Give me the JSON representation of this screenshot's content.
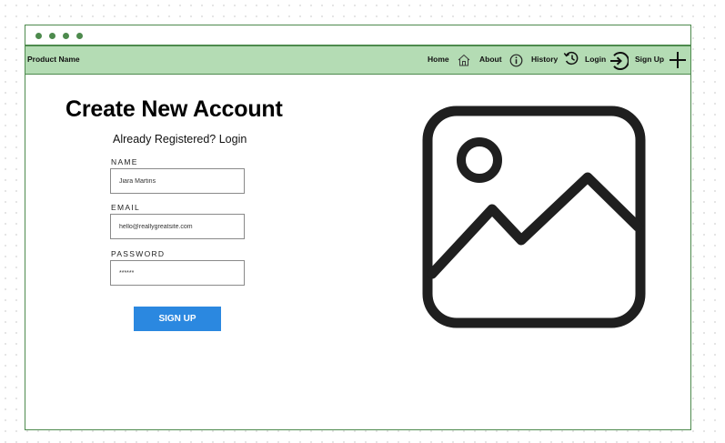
{
  "window": {
    "dots": [
      "dot-1",
      "dot-2",
      "dot-3",
      "dot-4"
    ]
  },
  "navbar": {
    "brand": "Product Name",
    "items": [
      {
        "label": "Home",
        "icon": "home-icon"
      },
      {
        "label": "About",
        "icon": "info-icon"
      },
      {
        "label": "History",
        "icon": "history-icon"
      },
      {
        "label": "Login",
        "icon": "login-icon"
      },
      {
        "label": "Sign Up",
        "icon": "plus-icon"
      }
    ]
  },
  "form": {
    "title": "Create New Account",
    "subtitle": "Already Registered? Login",
    "name_label": "NAME",
    "name_value": "Jiara Martins",
    "email_label": "EMAIL",
    "email_value": "hello@reallygreatsite.com",
    "password_label": "PASSWORD",
    "password_value": "******",
    "submit_label": "SIGN UP"
  },
  "image": {
    "icon": "image-placeholder-icon"
  },
  "colors": {
    "border": "#4d8a4d",
    "navbar_bg": "#b4dcb4",
    "button": "#2b88e0",
    "icon_stroke": "#1f1f1f"
  }
}
